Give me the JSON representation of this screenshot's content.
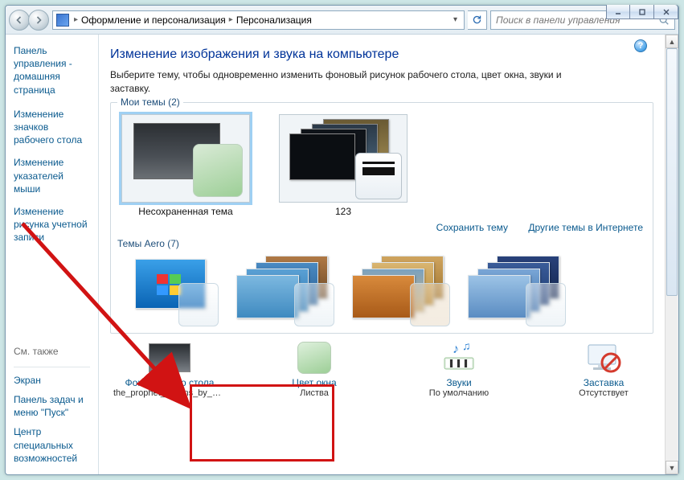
{
  "window_controls": {
    "min": "–",
    "max": "□",
    "close": "✕"
  },
  "breadcrumb": {
    "level1": "Оформление и персонализация",
    "level2": "Персонализация"
  },
  "search": {
    "placeholder": "Поиск в панели управления"
  },
  "sidebar": {
    "home1": "Панель управления -",
    "home2": "домашняя страница",
    "links": [
      "Изменение значков рабочего стола",
      "Изменение указателей мыши",
      "Изменение рисунка учетной записи"
    ],
    "see_also_header": "См. также",
    "see_also": [
      "Экран",
      "Панель задач и меню \"Пуск\"",
      "Центр специальных возможностей"
    ]
  },
  "main": {
    "title": "Изменение изображения и звука на компьютере",
    "subtitle": "Выберите тему, чтобы одновременно изменить фоновый рисунок рабочего стола, цвет окна, звуки и заставку.",
    "group_my_themes": "Мои темы (2)",
    "theme1": "Несохраненная тема",
    "theme2": "123",
    "link_save": "Сохранить тему",
    "link_more": "Другие темы в Интернете",
    "group_aero": "Темы Aero (7)"
  },
  "settings": {
    "bg": {
      "label": "Фон рабочего стола",
      "value": "the_prophet_returns_by_m..."
    },
    "color": {
      "label": "Цвет окна",
      "value": "Листва"
    },
    "sounds": {
      "label": "Звуки",
      "value": "По умолчанию"
    },
    "saver": {
      "label": "Заставка",
      "value": "Отсутствует"
    }
  }
}
